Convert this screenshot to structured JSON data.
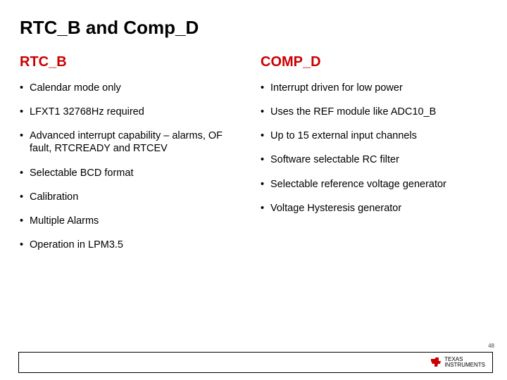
{
  "title": "RTC_B and Comp_D",
  "left": {
    "heading": "RTC_B",
    "items": [
      "Calendar mode only",
      "LFXT1 32768Hz required",
      "Advanced interrupt capability – alarms, OF fault, RTCREADY and RTCEV",
      "Selectable BCD format",
      "Calibration",
      "Multiple Alarms",
      "Operation in LPM3.5"
    ]
  },
  "right": {
    "heading": "COMP_D",
    "items": [
      "Interrupt driven for low power",
      "Uses the REF module like ADC10_B",
      "Up to 15 external input channels",
      "Software selectable RC filter",
      "Selectable reference voltage generator",
      "Voltage Hysteresis generator"
    ]
  },
  "page_number": "48",
  "footer": {
    "logo_line1": "TEXAS",
    "logo_line2": "INSTRUMENTS"
  }
}
